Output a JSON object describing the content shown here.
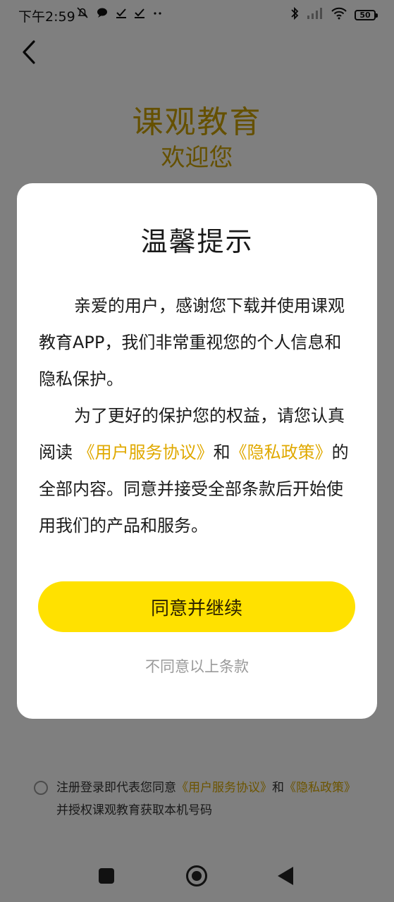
{
  "status_bar": {
    "time": "下午2:59",
    "left_icons": [
      "mute-icon",
      "chat-icon",
      "check-icon",
      "check-icon",
      "more-dots-icon"
    ],
    "right_icons": [
      "bluetooth-icon",
      "signal-icon",
      "wifi-icon"
    ],
    "battery": "50"
  },
  "brand": {
    "title": "课观教育",
    "subtitle": "欢迎您"
  },
  "consent": {
    "prefix": "注册登录即代表您同意",
    "link1": "《用户服务协议》",
    "and": "和",
    "link2": "《隐私政策》",
    "suffix": "并授权课观教育获取本机号码"
  },
  "dialog": {
    "title": "温馨提示",
    "para1": "亲爱的用户，感谢您下载并使用课观教育APP，我们非常重视您的个人信息和隐私保护。",
    "para2_prefix": "为了更好的保护您的权益，请您认真阅读",
    "link_terms": "《用户服务协议》",
    "para2_and": "和",
    "link_privacy": "《隐私政策》",
    "para2_suffix": "的全部内容。同意并接受全部条款后开始使用我们的产品和服务。",
    "agree_label": "同意并继续",
    "disagree_label": "不同意以上条款"
  },
  "colors": {
    "brand_gold": "#caa100",
    "link_gold": "#e0a900",
    "button_yellow": "#ffe100",
    "overlay": "rgba(0,0,0,0.5)"
  }
}
